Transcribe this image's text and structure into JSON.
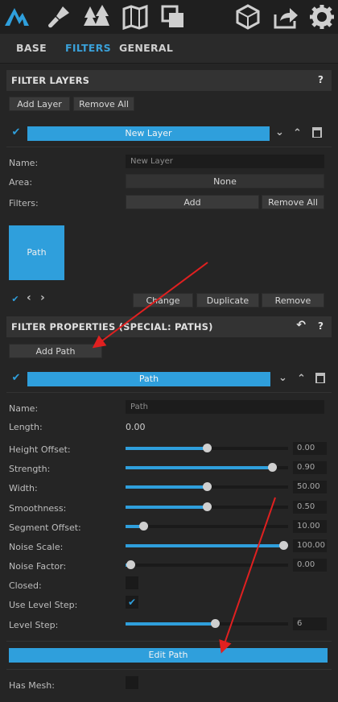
{
  "toolbar": {
    "icons": [
      "logo-mountain-icon",
      "brush-tool-icon",
      "forest-trees-icon",
      "map-icon",
      "layers-copy-icon",
      "cube-icon",
      "share-export-icon",
      "gear-icon"
    ]
  },
  "tabs": {
    "base": "BASE",
    "filters": "FILTERS",
    "general": "GENERAL",
    "active": "FILTERS"
  },
  "filter_layers": {
    "title": "FILTER LAYERS",
    "help": "?",
    "add_layer": "Add Layer",
    "remove_all": "Remove All",
    "layer_bar": "New Layer",
    "name_label": "Name:",
    "name_value": "New Layer",
    "area_label": "Area:",
    "area_value": "None",
    "filters_label": "Filters:",
    "filters_add": "Add",
    "filters_remove_all": "Remove All",
    "tile_label": "Path",
    "change": "Change",
    "duplicate": "Duplicate",
    "remove": "Remove"
  },
  "filter_properties": {
    "title": "FILTER PROPERTIES (SPECIAL: PATHS)",
    "help": "?",
    "back": "↶",
    "add_path": "Add Path",
    "path_bar": "Path",
    "name_label": "Name:",
    "name_value": "Path",
    "length_label": "Length:",
    "length_value": "0.00",
    "sliders": [
      {
        "label": "Height Offset:",
        "value": "0.00",
        "position": 0.5
      },
      {
        "label": "Strength:",
        "value": "0.90",
        "position": 0.9
      },
      {
        "label": "Width:",
        "value": "50.00",
        "position": 0.5
      },
      {
        "label": "Smoothness:",
        "value": "0.50",
        "position": 0.5
      },
      {
        "label": "Segment Offset:",
        "value": "10.00",
        "position": 0.11
      },
      {
        "label": "Noise Scale:",
        "value": "100.00",
        "position": 0.97
      },
      {
        "label": "Noise Factor:",
        "value": "0.00",
        "position": 0.03
      }
    ],
    "closed_label": "Closed:",
    "use_level_step_label": "Use Level Step:",
    "level_step_label": "Level Step:",
    "level_step_value": "6",
    "level_step_position": 0.55,
    "edit_path": "Edit Path",
    "has_mesh_label": "Has Mesh:"
  },
  "colors": {
    "accent": "#2f9fdc",
    "annotation_arrow": "#e02020"
  }
}
